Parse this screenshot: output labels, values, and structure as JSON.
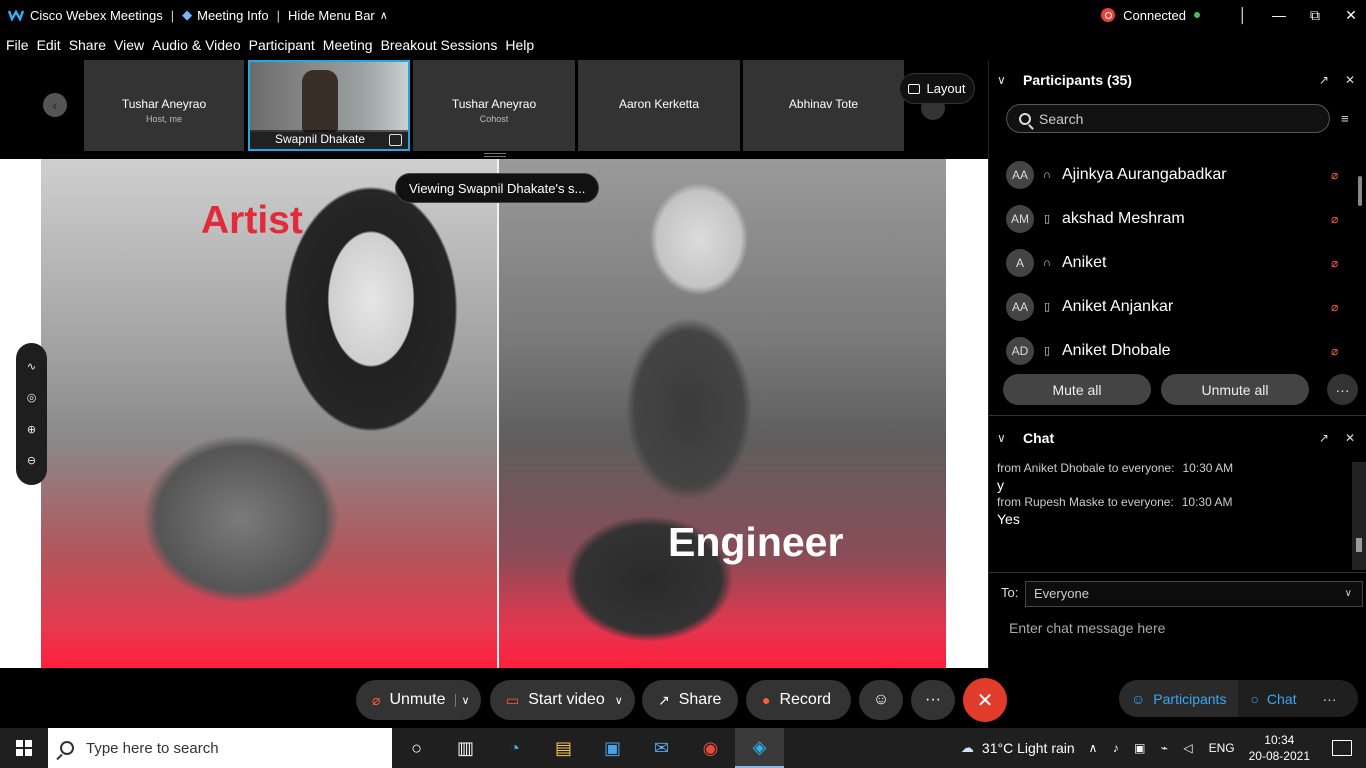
{
  "titlebar": {
    "app_name": "Cisco Webex Meetings",
    "sep1": "|",
    "meeting_info": "Meeting Info",
    "sep2": "|",
    "hide_menu_bar": "Hide Menu Bar",
    "status": "Connected"
  },
  "menu": [
    "File",
    "Edit",
    "Share",
    "View",
    "Audio & Video",
    "Participant",
    "Meeting",
    "Breakout Sessions",
    "Help"
  ],
  "filmstrip": {
    "tiles": [
      {
        "name": "Tushar Aneyrao",
        "role": "Host, me"
      },
      {
        "name": "Swapnil Dhakate",
        "role": ""
      },
      {
        "name": "Tushar Aneyrao",
        "role": "Cohost"
      },
      {
        "name": "Aaron Kerketta",
        "role": ""
      },
      {
        "name": "Abhinav Tote",
        "role": ""
      }
    ],
    "layout_label": "Layout"
  },
  "stage": {
    "viewing": "Viewing Swapnil Dhakate's s...",
    "slide_left_title": "Artist",
    "slide_right_title": "Engineer"
  },
  "participants_panel": {
    "title": "Participants (35)",
    "search_placeholder": "Search",
    "rows": [
      {
        "initials": "AA",
        "device": "headset",
        "name": "Ajinkya Aurangabadkar"
      },
      {
        "initials": "AM",
        "device": "phone",
        "name": "akshad Meshram"
      },
      {
        "initials": "A",
        "device": "headset",
        "name": "Aniket"
      },
      {
        "initials": "AA",
        "device": "phone",
        "name": "Aniket Anjankar"
      },
      {
        "initials": "AD",
        "device": "phone",
        "name": "Aniket Dhobale"
      }
    ],
    "mute_all": "Mute all",
    "unmute_all": "Unmute all"
  },
  "chat_panel": {
    "title": "Chat",
    "messages": [
      {
        "meta": "from Aniket Dhobale to everyone:",
        "time": "10:30 AM",
        "text": "y"
      },
      {
        "meta": "from Rupesh Maske to everyone:",
        "time": "10:30 AM",
        "text": "Yes"
      }
    ],
    "to_label": "To:",
    "to_value": "Everyone",
    "input_placeholder": "Enter chat message here"
  },
  "toolbar": {
    "unmute": "Unmute",
    "start_video": "Start video",
    "share": "Share",
    "record": "Record",
    "participants_tab": "Participants",
    "chat_tab": "Chat"
  },
  "taskbar": {
    "search_placeholder": "Type here to search",
    "weather": "31°C  Light rain",
    "lang": "ENG",
    "time": "10:34",
    "date": "20-08-2021"
  },
  "colors": {
    "accent": "#27a6e5",
    "end_call": "#e13b2b",
    "mic_off": "#ff5a3c",
    "artist_text": "#e12b3b"
  }
}
